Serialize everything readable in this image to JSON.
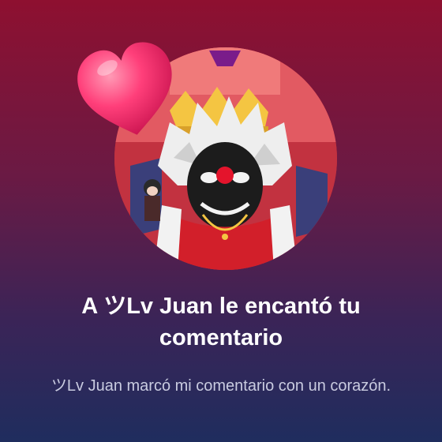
{
  "notification": {
    "headline": "A ツLv Juan le encantó tu comentario",
    "body": "ツLv Juan marcó mi comentario con un corazón.",
    "avatar_icon": "profile-avatar-icon",
    "reaction_icon": "heart-icon"
  },
  "colors": {
    "gradient_top": "#8e1030",
    "gradient_bottom": "#1f2d5e",
    "heart": "#ff3f7a",
    "subtext": "#c9cbe0"
  }
}
